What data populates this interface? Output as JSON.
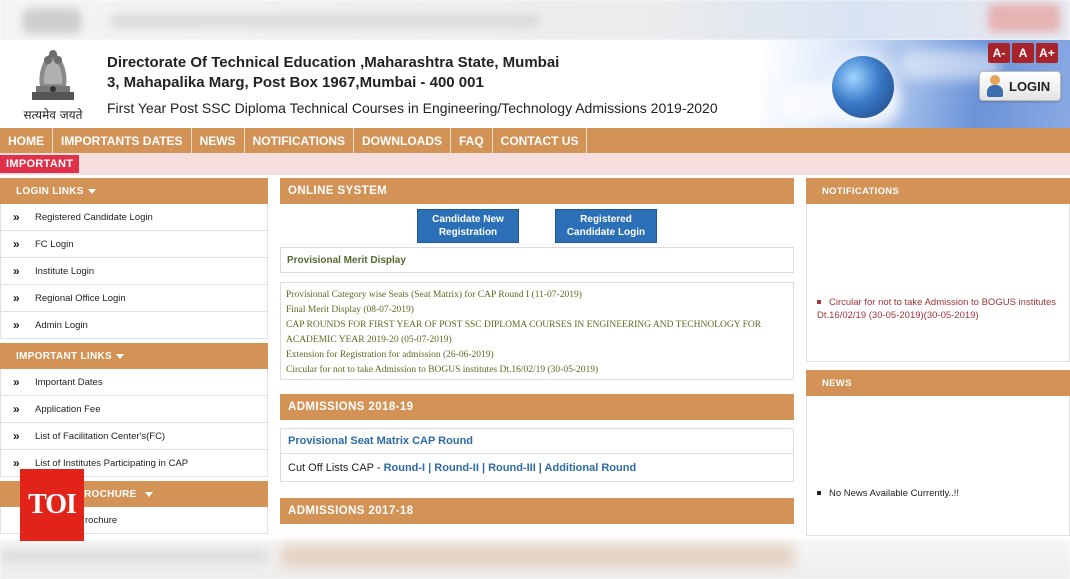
{
  "header": {
    "line1": "Directorate Of Technical Education ,Maharashtra State, Mumbai",
    "line2": "3, Mahapalika Marg, Post Box 1967,Mumbai - 400 001",
    "line3": "First Year Post SSC Diploma Technical Courses in Engineering/Technology Admissions 2019-2020",
    "motto": "सत्यमेव जयते",
    "font_buttons": [
      "A-",
      "A",
      "A+"
    ],
    "login_label": "LOGIN"
  },
  "nav": [
    "HOME",
    "IMPORTANTS DATES",
    "NEWS",
    "NOTIFICATIONS",
    "DOWNLOADS",
    "FAQ",
    "CONTACT US"
  ],
  "important_label": "IMPORTANT",
  "left": {
    "login_links": {
      "title": "LOGIN LINKS",
      "items": [
        "Registered Candidate Login",
        "FC Login",
        "Institute Login",
        "Regional Office Login",
        "Admin Login"
      ]
    },
    "important_links": {
      "title": "IMPORTANT LINKS",
      "items": [
        "Important Dates",
        "Application Fee",
        "List of Facilitation Center's(FC)",
        "List of Institutes Participating in CAP"
      ]
    },
    "brochure": {
      "title": "ROCHURE",
      "items": [
        "rochure"
      ]
    }
  },
  "middle": {
    "online_title": "ONLINE SYSTEM",
    "btn_new": "Candidate New Registration",
    "btn_registered": "Registered Candidate Login",
    "merit": "Provisional Merit Display",
    "news": [
      "Provisional Category wise Seats (Seat Matrix) for CAP Round I (11-07-2019)",
      "Final Merit Display (08-07-2019)",
      "CAP ROUNDS FOR FIRST YEAR OF POST SSC DIPLOMA COURSES IN ENGINEERING AND TECHNOLOGY FOR ACADEMIC YEAR 2019-20 (05-07-2019)",
      "Extension for Registration for admission (26-06-2019)",
      "Circular for not to take Admission to BOGUS institutes Dt.16/02/19 (30-05-2019)"
    ],
    "adm1819_title": "ADMISSIONS 2018-19",
    "seat_matrix": "Provisional Seat Matrix CAP Round",
    "cutoff_prefix": "Cut Off Lists CAP -",
    "cutoff_links": "Round-I | Round-II | Round-III | Additional Round",
    "adm1718_title": "ADMISSIONS 2017-18"
  },
  "right": {
    "notif_title": "NOTIFICATIONS",
    "notif_text": "Circular for not to take Admission to BOGUS institutes Dt.16/02/19 (30-05-2019)(30-05-2019)",
    "news_title": "NEWS",
    "news_text": "No News Available Currently..!!"
  },
  "watermark": "TOI"
}
